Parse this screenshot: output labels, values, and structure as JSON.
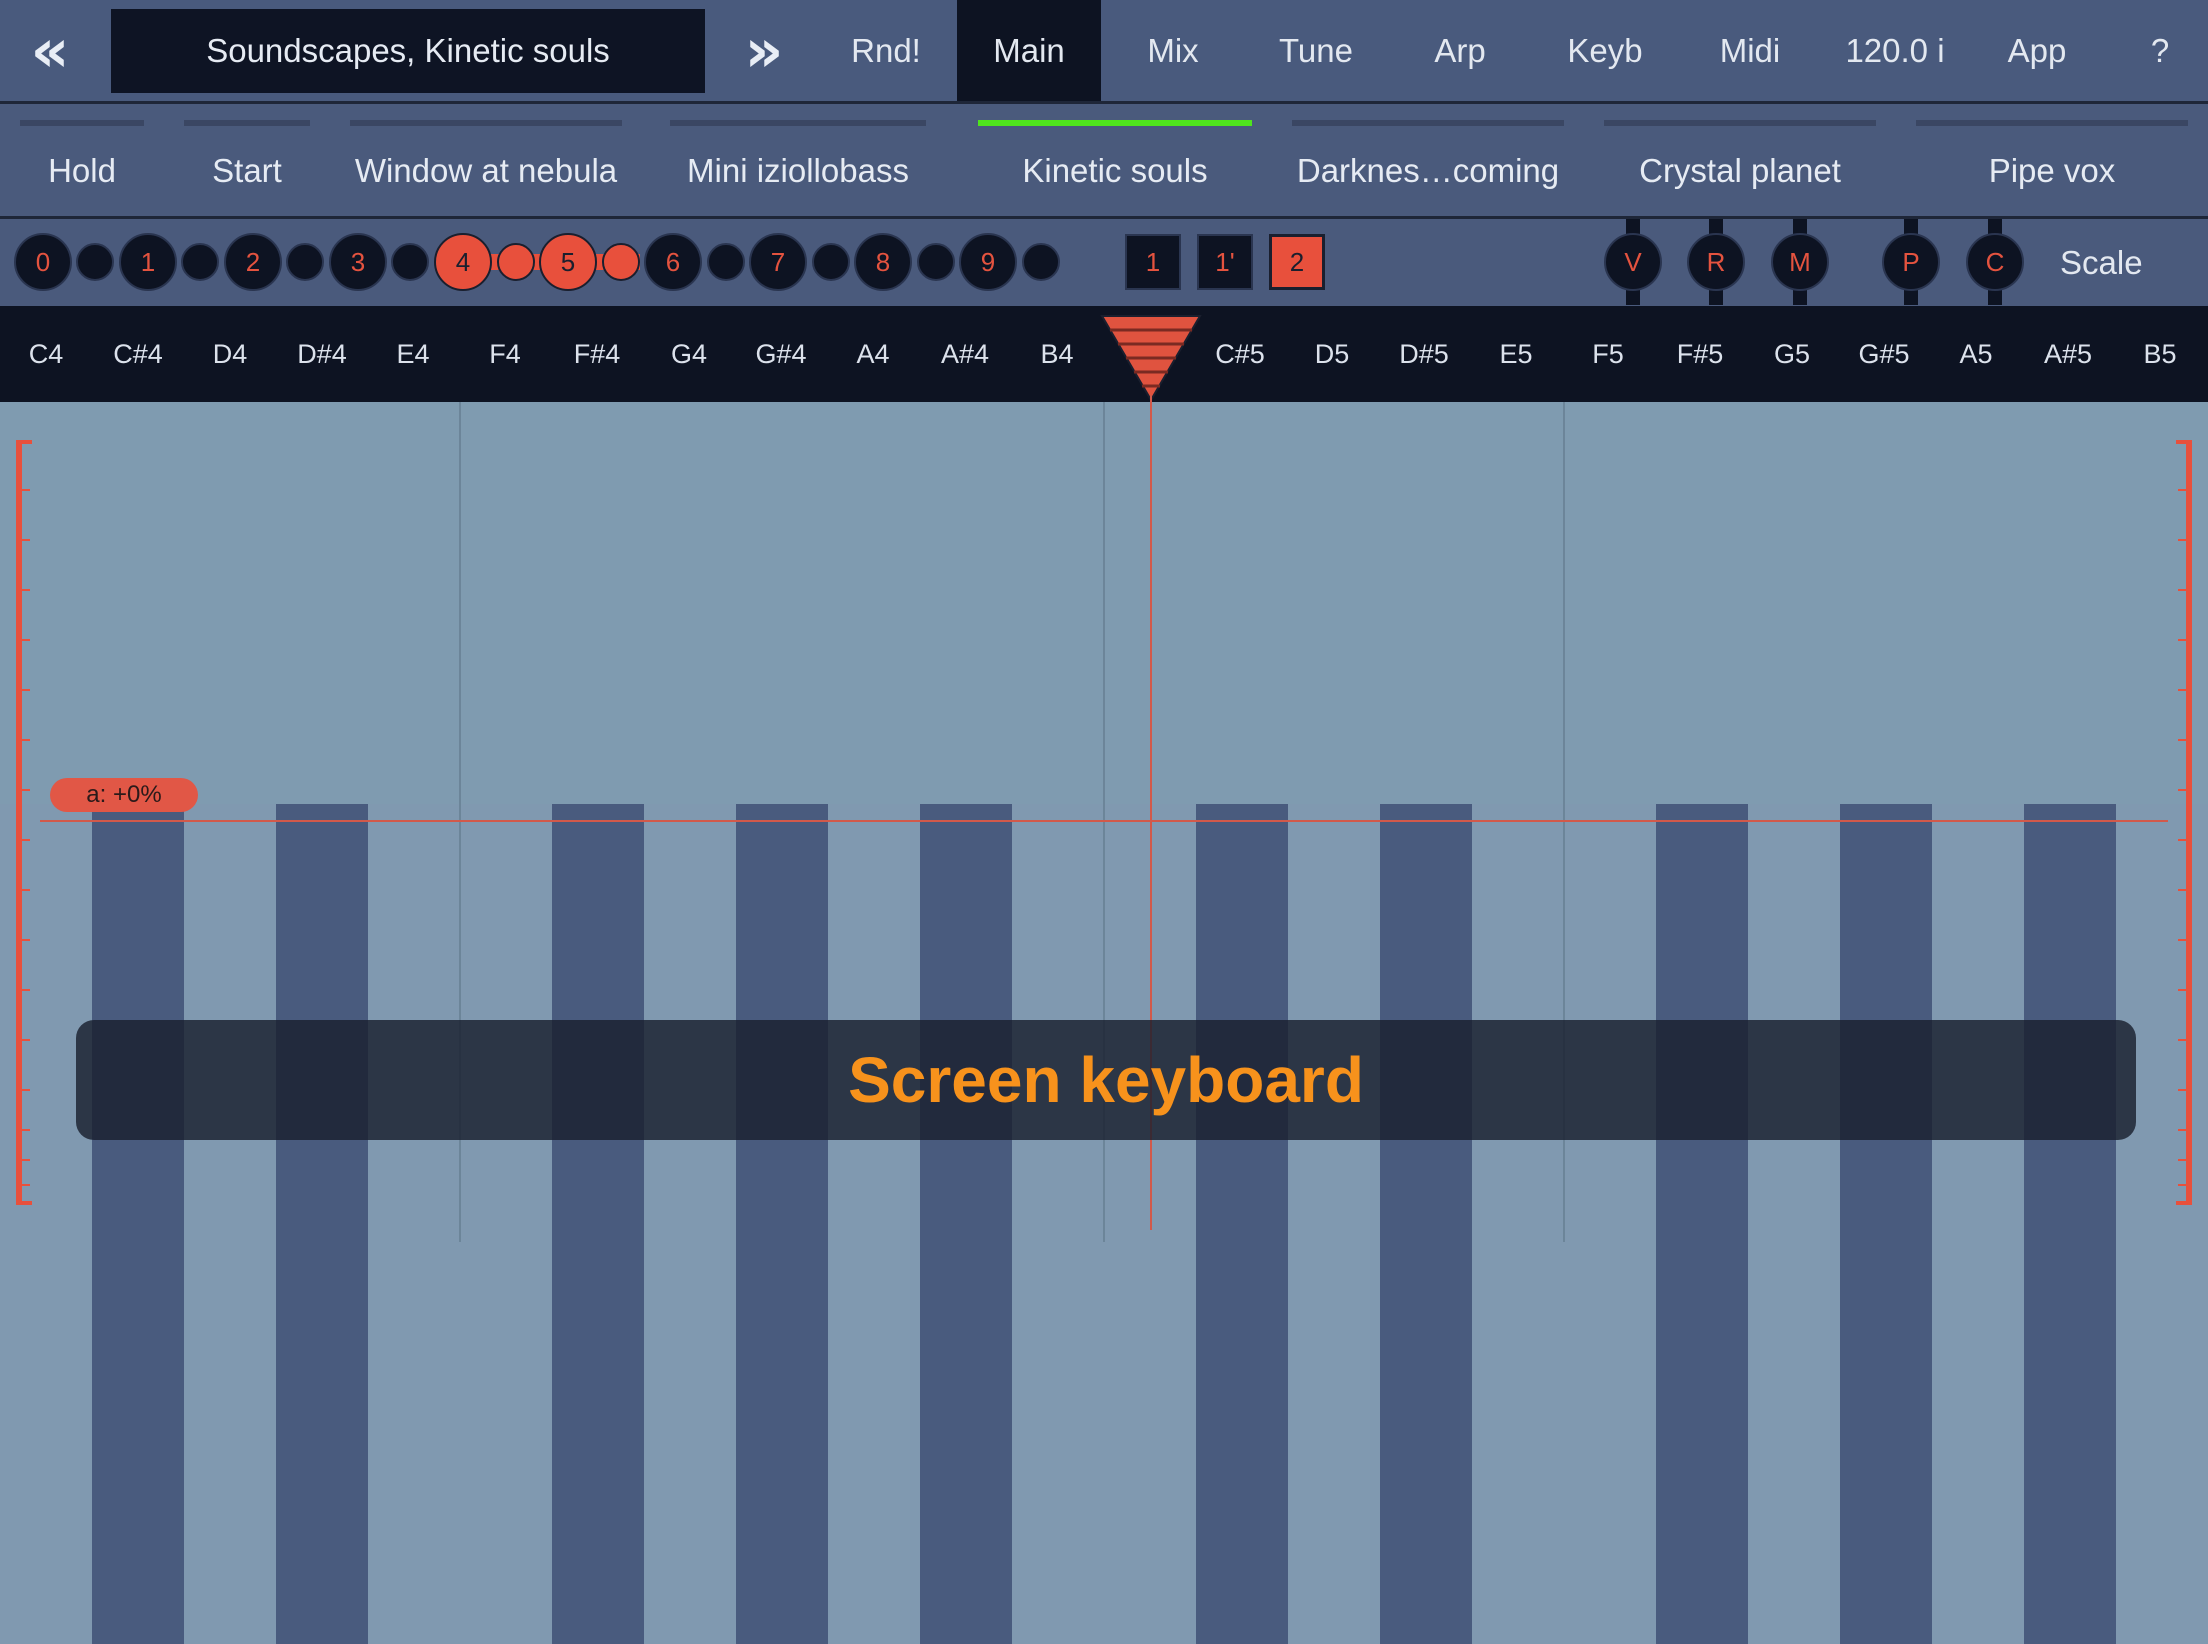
{
  "header": {
    "prev_label": "«",
    "next_label": "»",
    "preset_name": "Soundscapes, Kinetic souls",
    "tabs": [
      {
        "label": "Rnd!"
      },
      {
        "label": "Main"
      },
      {
        "label": "Mix"
      },
      {
        "label": "Tune"
      },
      {
        "label": "Arp"
      },
      {
        "label": "Keyb"
      },
      {
        "label": "Midi"
      },
      {
        "label": "120.0 i"
      },
      {
        "label": "App"
      },
      {
        "label": "?"
      }
    ],
    "active_tab": "Main"
  },
  "presets": [
    {
      "label": "Hold"
    },
    {
      "label": "Start"
    },
    {
      "label": "Window at nebula"
    },
    {
      "label": "Mini iziollobass"
    },
    {
      "label": "Kinetic souls"
    },
    {
      "label": "Darknes…coming"
    },
    {
      "label": "Crystal planet"
    },
    {
      "label": "Pipe vox"
    }
  ],
  "active_preset": "Kinetic souls",
  "controls": {
    "octaves": [
      {
        "label": "0"
      },
      {
        "label": "1"
      },
      {
        "label": "2"
      },
      {
        "label": "3"
      },
      {
        "label": "4"
      },
      {
        "label": "5"
      },
      {
        "label": "6"
      },
      {
        "label": "7"
      },
      {
        "label": "8"
      },
      {
        "label": "9"
      }
    ],
    "octave_range": [
      4,
      5
    ],
    "modes": [
      {
        "label": "1"
      },
      {
        "label": "1'"
      },
      {
        "label": "2"
      }
    ],
    "active_mode": "2",
    "toggles": [
      {
        "label": "V"
      },
      {
        "label": "R"
      },
      {
        "label": "M"
      },
      {
        "label": "P"
      },
      {
        "label": "C"
      }
    ],
    "scale_label": "Scale"
  },
  "keyboard": {
    "notes": [
      {
        "label": "C4"
      },
      {
        "label": "C#4"
      },
      {
        "label": "D4"
      },
      {
        "label": "D#4"
      },
      {
        "label": "E4"
      },
      {
        "label": "F4"
      },
      {
        "label": "F#4"
      },
      {
        "label": "G4"
      },
      {
        "label": "G#4"
      },
      {
        "label": "A4"
      },
      {
        "label": "A#4"
      },
      {
        "label": "B4"
      },
      {
        "label": ""
      },
      {
        "label": "C#5"
      },
      {
        "label": "D5"
      },
      {
        "label": "D#5"
      },
      {
        "label": "E5"
      },
      {
        "label": "F5"
      },
      {
        "label": "F#5"
      },
      {
        "label": "G5"
      },
      {
        "label": "G#5"
      },
      {
        "label": "A5"
      },
      {
        "label": "A#5"
      },
      {
        "label": "B5"
      }
    ],
    "aftertouch_label": "a: +0%",
    "caption": "Screen keyboard"
  },
  "colors": {
    "accent": "#e8503c",
    "active_preset_line": "#4fe41d",
    "caption_text": "#f7921c"
  }
}
